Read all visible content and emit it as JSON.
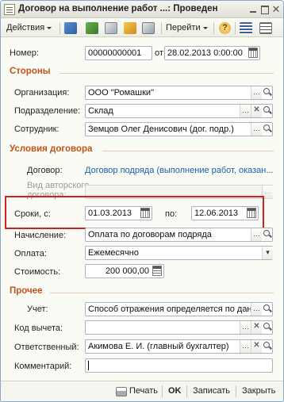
{
  "window": {
    "title": "Договор на выполнение работ ...: Проведен"
  },
  "toolbar": {
    "actions_label": "Действия",
    "goto_label": "Перейти",
    "help_label": "?"
  },
  "header": {
    "number_label": "Номер:",
    "number_value": "00000000001",
    "date_label": "от:",
    "date_value": "28.02.2013  0:00:00"
  },
  "sections": {
    "parties": "Стороны",
    "conditions": "Условия договора",
    "other": "Прочее"
  },
  "parties": {
    "org_label": "Организация:",
    "org_value": "ООО \"Ромашки\"",
    "dept_label": "Подразделение:",
    "dept_value": "Склад",
    "employee_label": "Сотрудник:",
    "employee_value": "Земцов Олег Денисович (дог. подр.)"
  },
  "conditions": {
    "contract_label": "Договор:",
    "contract_value": "Договор подряда (выполнение работ, оказан...",
    "author_kind_label_1": "Вид авторского",
    "author_kind_label_2": "договора:",
    "terms_label": "Сроки, с:",
    "date_from": "01.03.2013",
    "to_label": "по:",
    "date_to": "12.06.2013",
    "accrual_label": "Начисление:",
    "accrual_value": "Оплата по договорам подряда",
    "payment_label": "Оплата:",
    "payment_value": "Ежемесячно",
    "cost_label": "Стоимость:",
    "cost_value": "200 000,00"
  },
  "other": {
    "accounting_label": "Учет:",
    "accounting_value": "Способ отражения определяется по данны",
    "deduction_label": "Код вычета:",
    "deduction_value": "",
    "responsible_label": "Ответственный:",
    "responsible_value": "Акимова Е. И. (главный бухгалтер)",
    "comment_label": "Комментарий:",
    "comment_value": ""
  },
  "footer": {
    "print_label": "Печать",
    "ok_label": "OK",
    "save_label": "Записать",
    "close_label": "Закрыть"
  },
  "colors": {
    "section_title": "#c0541a",
    "highlight_frame": "#d41f1f",
    "link": "#1a5fa8"
  }
}
